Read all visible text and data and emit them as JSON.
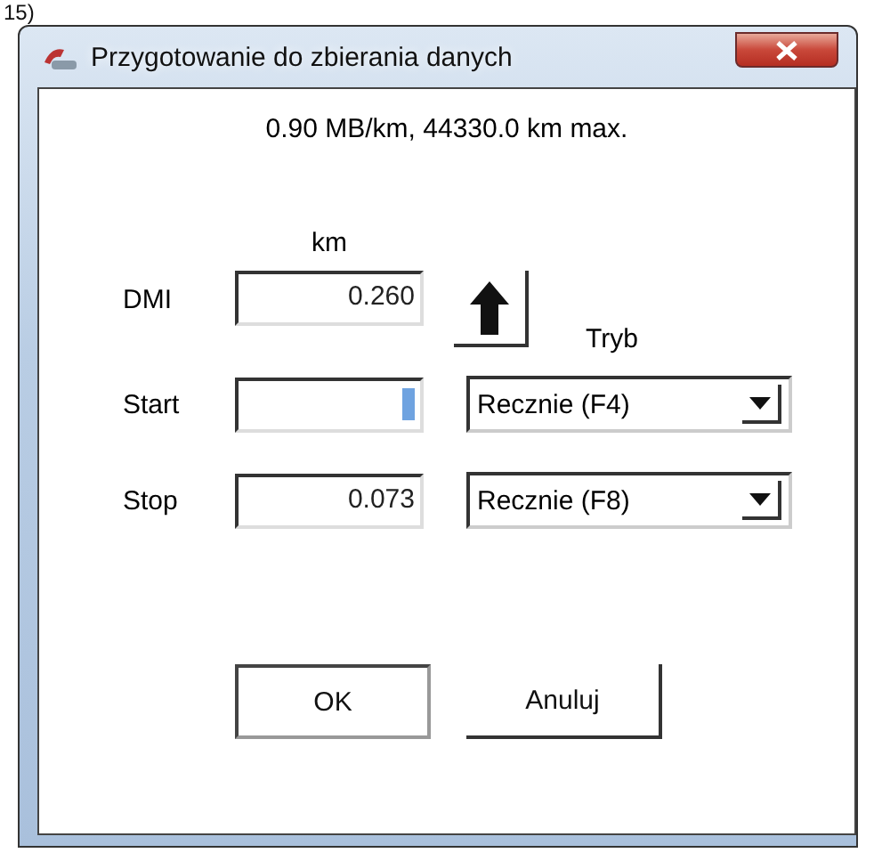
{
  "figure_label": "15)",
  "window": {
    "title": "Przygotowanie do zbierania danych"
  },
  "info": "0.90 MB/km,  44330.0 km max.",
  "unit_label": "km",
  "mode_label": "Tryb",
  "rows": [
    {
      "kind": "dmi",
      "label": "DMI",
      "value": "0.260"
    },
    {
      "kind": "trigger",
      "label": "Start",
      "text_selected": true,
      "mode": "Recznie (F4)"
    },
    {
      "kind": "trigger",
      "label": "Stop",
      "value": "0.073",
      "text_selected": false,
      "mode": "Recznie (F8)"
    }
  ],
  "buttons": [
    {
      "label": "OK",
      "default": true
    },
    {
      "label": "Anuluj",
      "default": false
    }
  ]
}
